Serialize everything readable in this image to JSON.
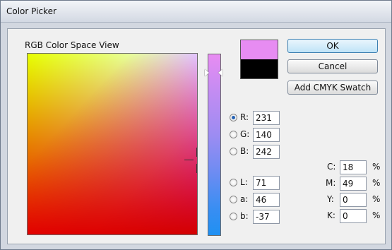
{
  "window": {
    "title": "Color Picker"
  },
  "view": {
    "label": "RGB Color Space View"
  },
  "colors": {
    "new": "#e78cf2",
    "old": "#000000",
    "accent": "#3c7fb1"
  },
  "buttons": {
    "ok": "OK",
    "cancel": "Cancel",
    "add_cmyk": "Add CMYK Swatch"
  },
  "rgb": [
    {
      "label": "R:",
      "value": "231",
      "checked": true
    },
    {
      "label": "G:",
      "value": "140",
      "checked": false
    },
    {
      "label": "B:",
      "value": "242",
      "checked": false
    }
  ],
  "lab": [
    {
      "label": "L:",
      "value": "71",
      "checked": false
    },
    {
      "label": "a:",
      "value": "46",
      "checked": false
    },
    {
      "label": "b:",
      "value": "-37",
      "checked": false
    }
  ],
  "cmyk": [
    {
      "label": "C:",
      "value": "18",
      "unit": "%"
    },
    {
      "label": "M:",
      "value": "49",
      "unit": "%"
    },
    {
      "label": "Y:",
      "value": "0",
      "unit": "%"
    },
    {
      "label": "K:",
      "value": "0",
      "unit": "%"
    }
  ]
}
